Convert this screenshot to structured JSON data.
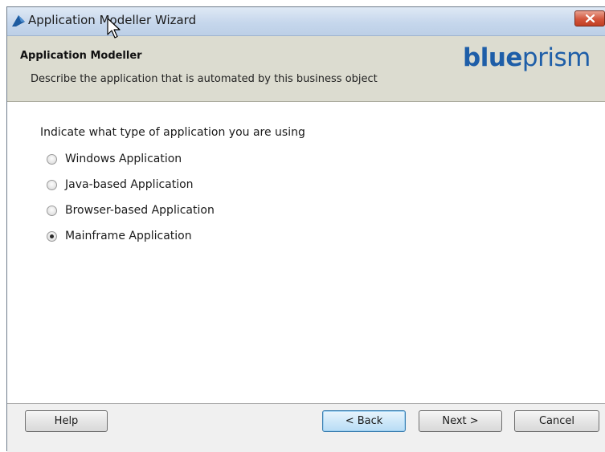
{
  "window": {
    "title": "Application Modeller Wizard",
    "close_symbol": "×"
  },
  "header": {
    "title": "Application Modeller",
    "description": "Describe the application that is automated by this business object",
    "logo_part1": "blue",
    "logo_part2": "prism"
  },
  "content": {
    "prompt": "Indicate what type of application you are using",
    "options": [
      {
        "label": "Windows Application",
        "checked": false
      },
      {
        "label": "Java-based Application",
        "checked": false
      },
      {
        "label": "Browser-based Application",
        "checked": false
      },
      {
        "label": "Mainframe Application",
        "checked": true
      }
    ]
  },
  "footer": {
    "help": "Help",
    "back": "< Back",
    "next": "Next >",
    "cancel": "Cancel"
  },
  "colors": {
    "logo_blue": "#1e5ea8",
    "header_bg": "#dcdcd0",
    "close_red": "#c13f23"
  }
}
